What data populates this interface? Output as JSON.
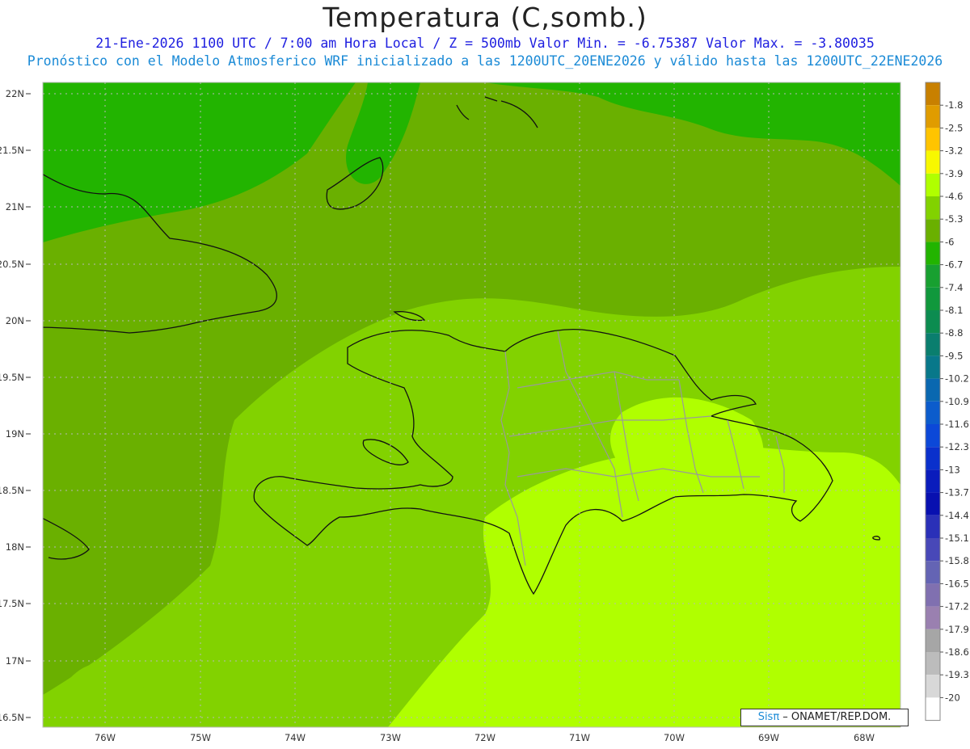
{
  "title": "Temperatura (C,somb.)",
  "subtitle_line1": "21-Ene-2026  1100 UTC / 7:00 am Hora Local / Z = 500mb  Valor Min. = -6.75387  Valor Max. = -3.80035",
  "subtitle_line2": "Pronóstico con el Modelo Atmosferico WRF inicializado a las 1200UTC_20ENE2026 y válido hasta las  1200UTC_22ENE2026",
  "credit": {
    "logo": "Sisπ",
    "org": " – ONAMET/REP.DOM."
  },
  "map": {
    "lat_labels": [
      "22N",
      "21.5N",
      "21N",
      "20.5N",
      "20N",
      "19.5N",
      "19N",
      "18.5N",
      "18N",
      "17.5N",
      "17N",
      "16.5N"
    ],
    "lon_labels": [
      "76W",
      "75W",
      "74W",
      "73W",
      "72W",
      "71W",
      "70W",
      "69W",
      "68W"
    ],
    "background_field_color": "#6ab000"
  },
  "colorbar": {
    "levels": [
      "-1.8",
      "-2.5",
      "-3.2",
      "-3.9",
      "-4.6",
      "-5.3",
      "-6",
      "-6.7",
      "-7.4",
      "-8.1",
      "-8.8",
      "-9.5",
      "-10.2",
      "-10.9",
      "-11.6",
      "-12.3",
      "-13",
      "-13.7",
      "-14.4",
      "-15.1",
      "-15.8",
      "-16.5",
      "-17.2",
      "-17.9",
      "-18.6",
      "-19.3",
      "-20"
    ],
    "colors": [
      "#c88000",
      "#e09c00",
      "#ffc400",
      "#f8f800",
      "#b0ff00",
      "#82d200",
      "#6ab000",
      "#22b400",
      "#18a030",
      "#10983c",
      "#0c8c50",
      "#0a7e6e",
      "#08788a",
      "#0a68b0",
      "#0c5ccc",
      "#0c48d8",
      "#0a30cc",
      "#0a1cbc",
      "#0810b0",
      "#2a30b8",
      "#4848b8",
      "#6464b4",
      "#8070b0",
      "#9a80b0",
      "#a6a6a6",
      "#bcbcbc",
      "#d8d8d8",
      "#ffffff"
    ]
  }
}
